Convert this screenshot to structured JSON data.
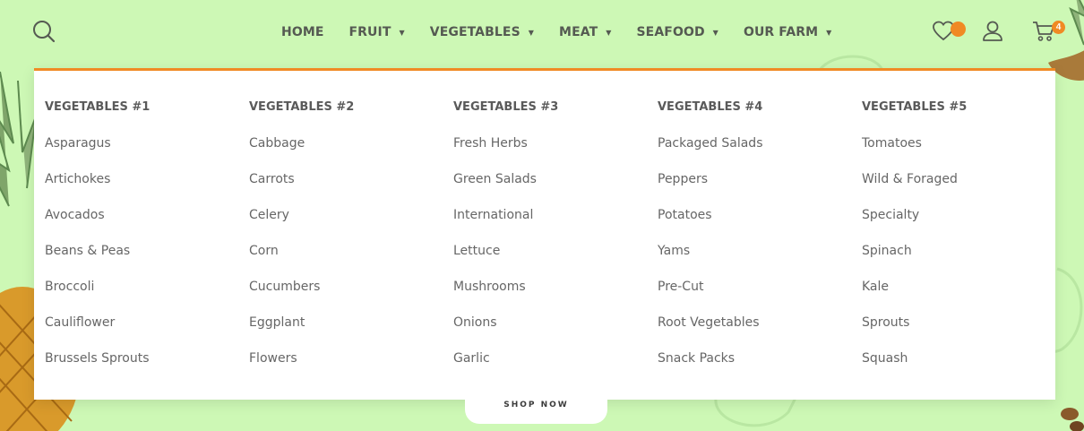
{
  "header": {
    "nav": [
      {
        "label": "HOME",
        "has_dropdown": false
      },
      {
        "label": "FRUIT",
        "has_dropdown": true
      },
      {
        "label": "VEGETABLES",
        "has_dropdown": true
      },
      {
        "label": "MEAT",
        "has_dropdown": true
      },
      {
        "label": "SEAFOOD",
        "has_dropdown": true
      },
      {
        "label": "OUR FARM",
        "has_dropdown": true
      }
    ],
    "cart_count": "4",
    "icons": [
      "search-icon",
      "heart-icon",
      "user-icon",
      "cart-icon",
      "caret-down-icon"
    ]
  },
  "mega_menu": {
    "columns": [
      {
        "title": "VEGETABLES #1",
        "items": [
          "Asparagus",
          "Artichokes",
          "Avocados",
          "Beans & Peas",
          "Broccoli",
          "Cauliflower",
          "Brussels Sprouts"
        ]
      },
      {
        "title": "VEGETABLES #2",
        "items": [
          "Cabbage",
          "Carrots",
          "Celery",
          "Corn",
          "Cucumbers",
          "Eggplant",
          "Flowers"
        ]
      },
      {
        "title": "VEGETABLES #3",
        "items": [
          "Fresh Herbs",
          "Green Salads",
          "International",
          "Lettuce",
          "Mushrooms",
          "Onions",
          "Garlic"
        ]
      },
      {
        "title": "VEGETABLES #4",
        "items": [
          "Packaged Salads",
          "Peppers",
          "Potatoes",
          "Yams",
          "Pre-Cut",
          "Root Vegetables",
          "Snack Packs"
        ]
      },
      {
        "title": "VEGETABLES #5",
        "items": [
          "Tomatoes",
          "Wild & Foraged",
          "Specialty",
          "Spinach",
          "Kale",
          "Sprouts",
          "Squash"
        ]
      }
    ]
  },
  "hero": {
    "button_label": "SHOP NOW"
  },
  "colors": {
    "background": "#cdf8b5",
    "accent": "#f08a24",
    "nav_text": "#555a52",
    "menu_text": "#666666"
  }
}
